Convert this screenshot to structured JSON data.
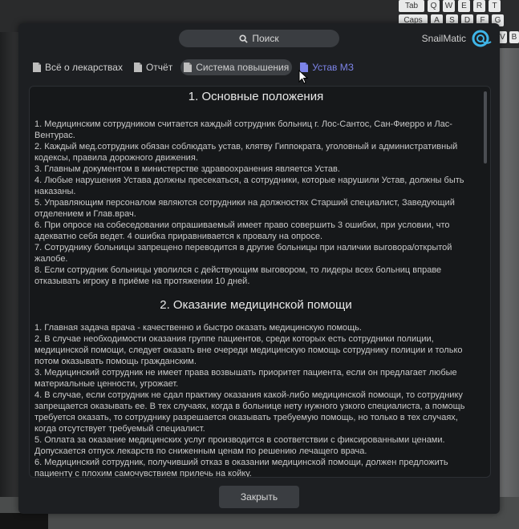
{
  "keyboard": {
    "row1": [
      "Tab",
      "Q",
      "W",
      "E",
      "R",
      "T"
    ],
    "row2": [
      "Caps",
      "A",
      "S",
      "D",
      "F",
      "G"
    ],
    "row3": [
      "V",
      "B"
    ]
  },
  "header": {
    "search_label": "Поиск",
    "search_icon": "search-icon",
    "brand_name": "SnailMatic",
    "brand_icon": "snail-logo-icon"
  },
  "tabs": [
    {
      "label": "Всё о лекарствах",
      "icon": "document-icon"
    },
    {
      "label": "Отчёт",
      "icon": "document-icon"
    },
    {
      "label": "Система повышения",
      "icon": "document-icon",
      "active": true
    },
    {
      "label": "Устав МЗ",
      "icon": "document-icon",
      "accent": true
    }
  ],
  "colors": {
    "accent": "#7d84e8",
    "window_bg": "#1d1f22",
    "content_bg": "#16181a"
  },
  "sections": [
    {
      "title": "1. Основные положения",
      "items": [
        "1. Медицинским сотрудником считается каждый сотрудник больниц г. Лос-Сантос, Сан-Фиерро и Лас-Вентурас.",
        "2. Каждый мед.сотрудник обязан соблюдать устав, клятву Гиппократа, уголовный и административный кодексы, правила дорожного движения.",
        "3. Главным документом в министерстве здравоохранения является Устав.",
        "4. Любые нарушения Устава должны пресекаться, а сотрудники, которые нарушили Устав, должны быть наказаны.",
        "5. Управляющим персоналом являются сотрудники на должностях Старший специалист, Заведующий отделением и Глав.врач.",
        "6. При опросе на собеседовании опрашиваемый имеет право совершить 3 ошибки, при условии, что адекватно себя ведет. 4 ошибка приравнивается к провалу на опросе.",
        "7. Сотруднику больницы запрещено переводится в другие больницы при наличии выговора/открытой жалобе.",
        "8. Если сотрудник больницы уволился с действующим выговором, то лидеры всех больниц вправе отказывать игроку в приёме на протяжении 10 дней."
      ]
    },
    {
      "title": "2. Оказание медицинской помощи",
      "items": [
        "1. Главная задача врача - качественно и быстро оказать медицинскую помощь.",
        "2. В случае необходимости оказания группе пациентов, среди которых есть сотрудники полиции, медицинской помощи, следует оказать вне очереди медицинскую помощь сотруднику полиции и только потом оказывать помощь гражданским.",
        "3. Медицинский сотрудник не имеет права возвышать приоритет пациента, если он предлагает любые материальные ценности, угрожает.",
        "4. В случае, если сотрудник не сдал практику оказания какой-либо медицинской помощи, то сотруднику запрещается оказывать ее. В тех случаях, когда в больнице нету нужного узкого специалиста, а помощь требуется оказать, то сотруднику разрешается оказывать требуемую помощь, но только в тех случаях, когда отсутствует требуемый специалист.",
        "5. Оплата за оказание медицинских услуг производится в соответствии с фиксированными ценами. Допускается отпуск лекарств по сниженным ценам по решению лечащего врача.",
        "6. Медицинский сотрудник, получивший отказ в оказании медицинской помощи, должен предложить пациенту с плохим самочувствием прилечь на койку."
      ]
    }
  ],
  "footer": {
    "close_label": "Закрыть"
  }
}
